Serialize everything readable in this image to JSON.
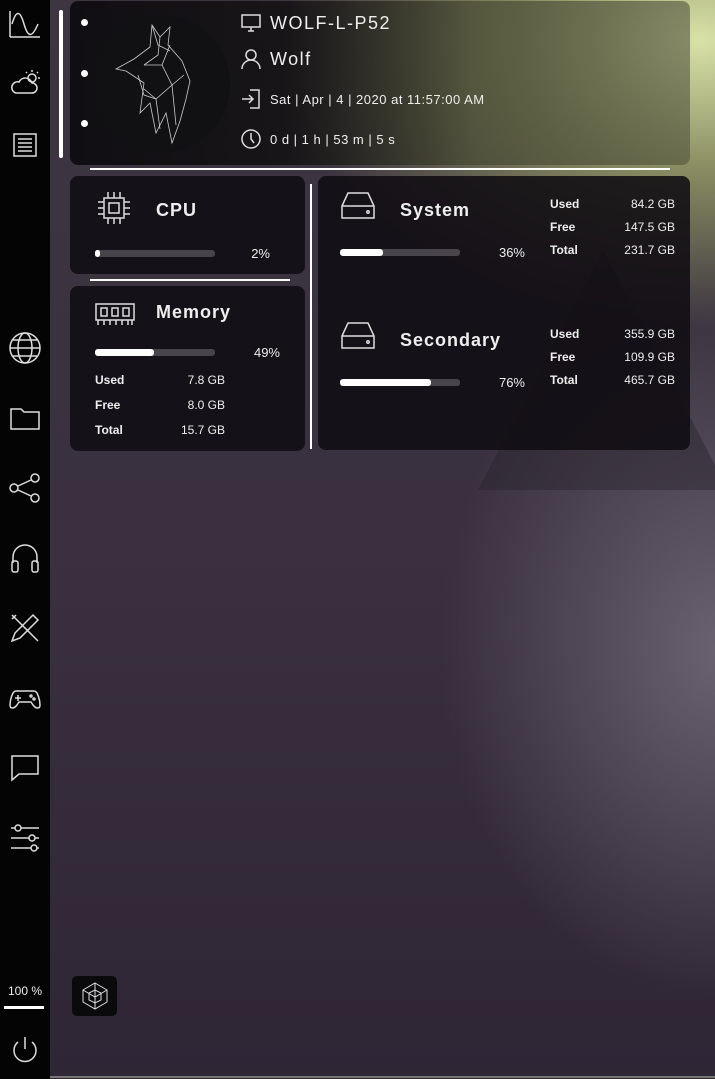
{
  "header": {
    "hostname": "WOLF-L-P52",
    "username": "Wolf",
    "login_time": "Sat | Apr | 4 | 2020 at 11:57:00 AM",
    "uptime": "0 d | 1 h | 53 m | 5 s"
  },
  "cpu": {
    "title": "CPU",
    "percent_label": "2%",
    "percent": 2
  },
  "memory": {
    "title": "Memory",
    "percent_label": "49%",
    "percent": 49,
    "rows": [
      {
        "label": "Used",
        "value": "7.8 GB"
      },
      {
        "label": "Free",
        "value": "8.0 GB"
      },
      {
        "label": "Total",
        "value": "15.7 GB"
      }
    ]
  },
  "disks": [
    {
      "title": "System",
      "percent_label": "36%",
      "percent": 36,
      "rows": [
        {
          "label": "Used",
          "value": "84.2 GB"
        },
        {
          "label": "Free",
          "value": "147.5 GB"
        },
        {
          "label": "Total",
          "value": "231.7 GB"
        }
      ]
    },
    {
      "title": "Secondary",
      "percent_label": "76%",
      "percent": 76,
      "rows": [
        {
          "label": "Used",
          "value": "355.9 GB"
        },
        {
          "label": "Free",
          "value": "109.9 GB"
        },
        {
          "label": "Total",
          "value": "465.7 GB"
        }
      ]
    }
  ],
  "sidebar": {
    "battery_label": "100 %",
    "battery": 100
  }
}
